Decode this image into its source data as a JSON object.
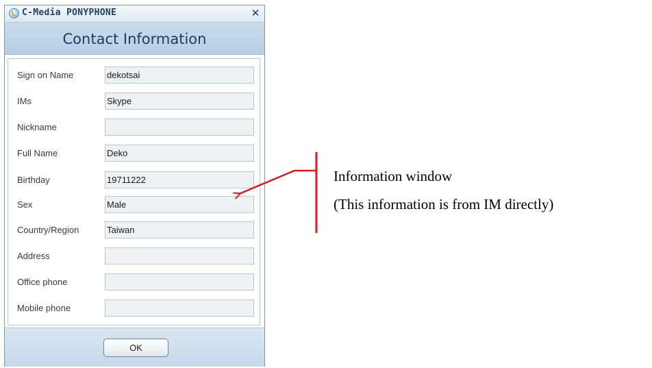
{
  "window": {
    "title": "C-Media PONYPHONE",
    "close_glyph": "✕",
    "header_title": "Contact Information"
  },
  "fields": [
    {
      "label": "Sign on Name",
      "value": "dekotsai"
    },
    {
      "label": "IMs",
      "value": "Skype"
    },
    {
      "label": "Nickname",
      "value": ""
    },
    {
      "label": "Full Name",
      "value": "Deko"
    },
    {
      "label": "Birthday",
      "value": "19711222"
    },
    {
      "label": "Sex",
      "value": "Male"
    },
    {
      "label": "Country/Region",
      "value": "Taiwan"
    },
    {
      "label": "Address",
      "value": ""
    },
    {
      "label": "Office phone",
      "value": ""
    },
    {
      "label": "Mobile phone",
      "value": ""
    }
  ],
  "footer": {
    "ok_label": "OK"
  },
  "annotation": {
    "line1": "Information window",
    "line2": "(This information is from IM directly)",
    "color": "#e8141b"
  },
  "icons": {
    "app": "app-logo-icon",
    "close": "close-icon"
  }
}
